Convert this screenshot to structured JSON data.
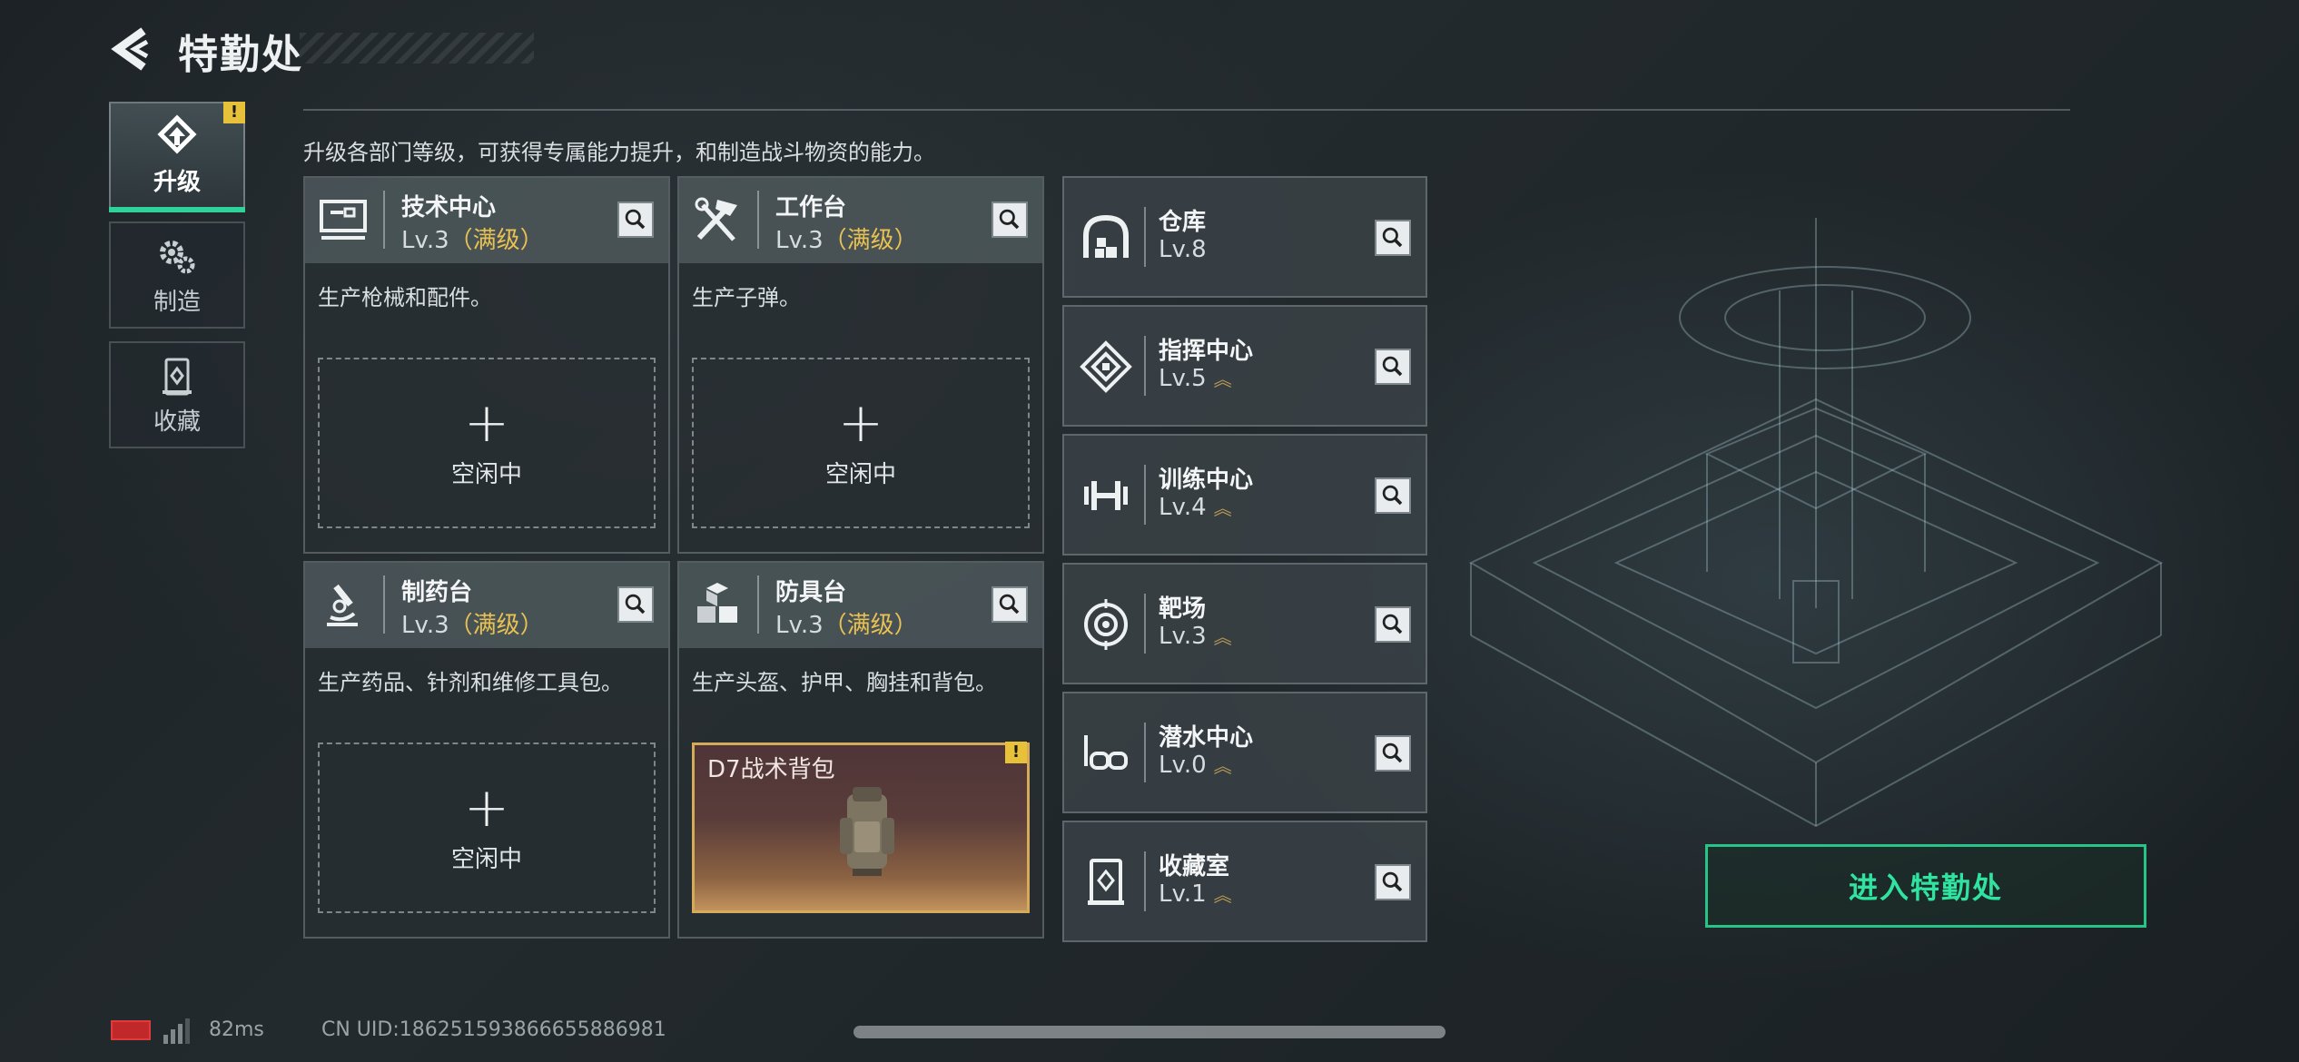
{
  "header": {
    "title": "特勤处",
    "back_icon": "back-arrow-icon"
  },
  "sidebar": {
    "tabs": [
      {
        "label": "升级",
        "icon": "upgrade-icon",
        "active": true,
        "alert": "!"
      },
      {
        "label": "制造",
        "icon": "gears-icon",
        "active": false
      },
      {
        "label": "收藏",
        "icon": "collection-icon",
        "active": false
      }
    ]
  },
  "description": "升级各部门等级，可获得专属能力提升，和制造战斗物资的能力。",
  "departments": [
    {
      "name": "技术中心",
      "level": "Lv.3",
      "status": "（满级）",
      "icon": "tech-center-icon",
      "desc": "生产枪械和配件。",
      "slot_plus": "+",
      "slot_status": "空闲中"
    },
    {
      "name": "工作台",
      "level": "Lv.3",
      "status": "（满级）",
      "icon": "workbench-icon",
      "desc": "生产子弹。",
      "slot_plus": "+",
      "slot_status": "空闲中"
    },
    {
      "name": "制药台",
      "level": "Lv.3",
      "status": "（满级）",
      "icon": "pharmacy-icon",
      "desc": "生产药品、针剂和维修工具包。",
      "slot_plus": "+",
      "slot_status": "空闲中"
    },
    {
      "name": "防具台",
      "level": "Lv.3",
      "status": "（满级）",
      "icon": "armor-bench-icon",
      "desc": "生产头盔、护甲、胸挂和背包。",
      "product": "D7战术背包",
      "product_alert": "!"
    }
  ],
  "facilities": [
    {
      "name": "仓库",
      "level": "Lv.8",
      "icon": "warehouse-icon",
      "upgradable": false
    },
    {
      "name": "指挥中心",
      "level": "Lv.5",
      "icon": "command-center-icon",
      "upgradable": true
    },
    {
      "name": "训练中心",
      "level": "Lv.4",
      "icon": "dumbbell-icon",
      "upgradable": true
    },
    {
      "name": "靶场",
      "level": "Lv.3",
      "icon": "target-icon",
      "upgradable": true
    },
    {
      "name": "潜水中心",
      "level": "Lv.0",
      "icon": "diving-mask-icon",
      "upgradable": true
    },
    {
      "name": "收藏室",
      "level": "Lv.1",
      "icon": "collection-room-icon",
      "upgradable": true
    }
  ],
  "enter_button": "进入特勤处",
  "status_bar": {
    "ping": "82ms",
    "uid": "CN UID:18625159386665588698​1"
  },
  "colors": {
    "accent": "#2fd39a",
    "maxed": "#e9c152",
    "alert": "#e8c13a"
  }
}
